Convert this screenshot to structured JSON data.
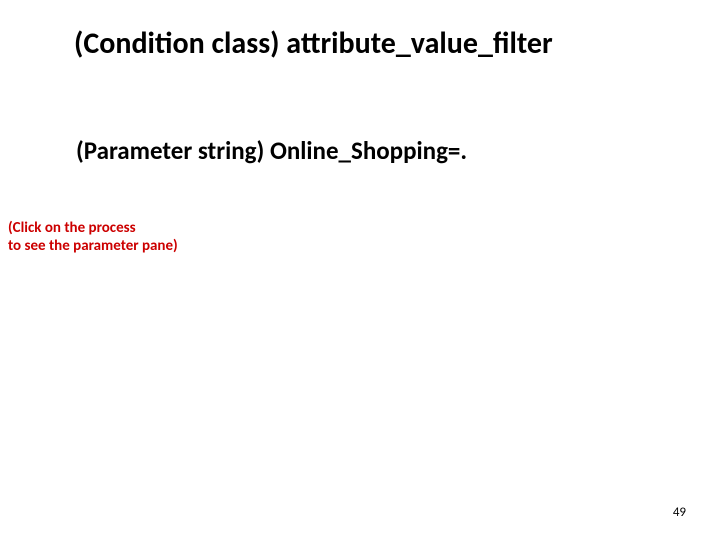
{
  "title": "(Condition class) attribute_value_filter",
  "subtitle": "(Parameter string) Online_Shopping=.",
  "hint_line1": "(Click on the process",
  "hint_line2": "to see the parameter pane)",
  "page_number": "49"
}
